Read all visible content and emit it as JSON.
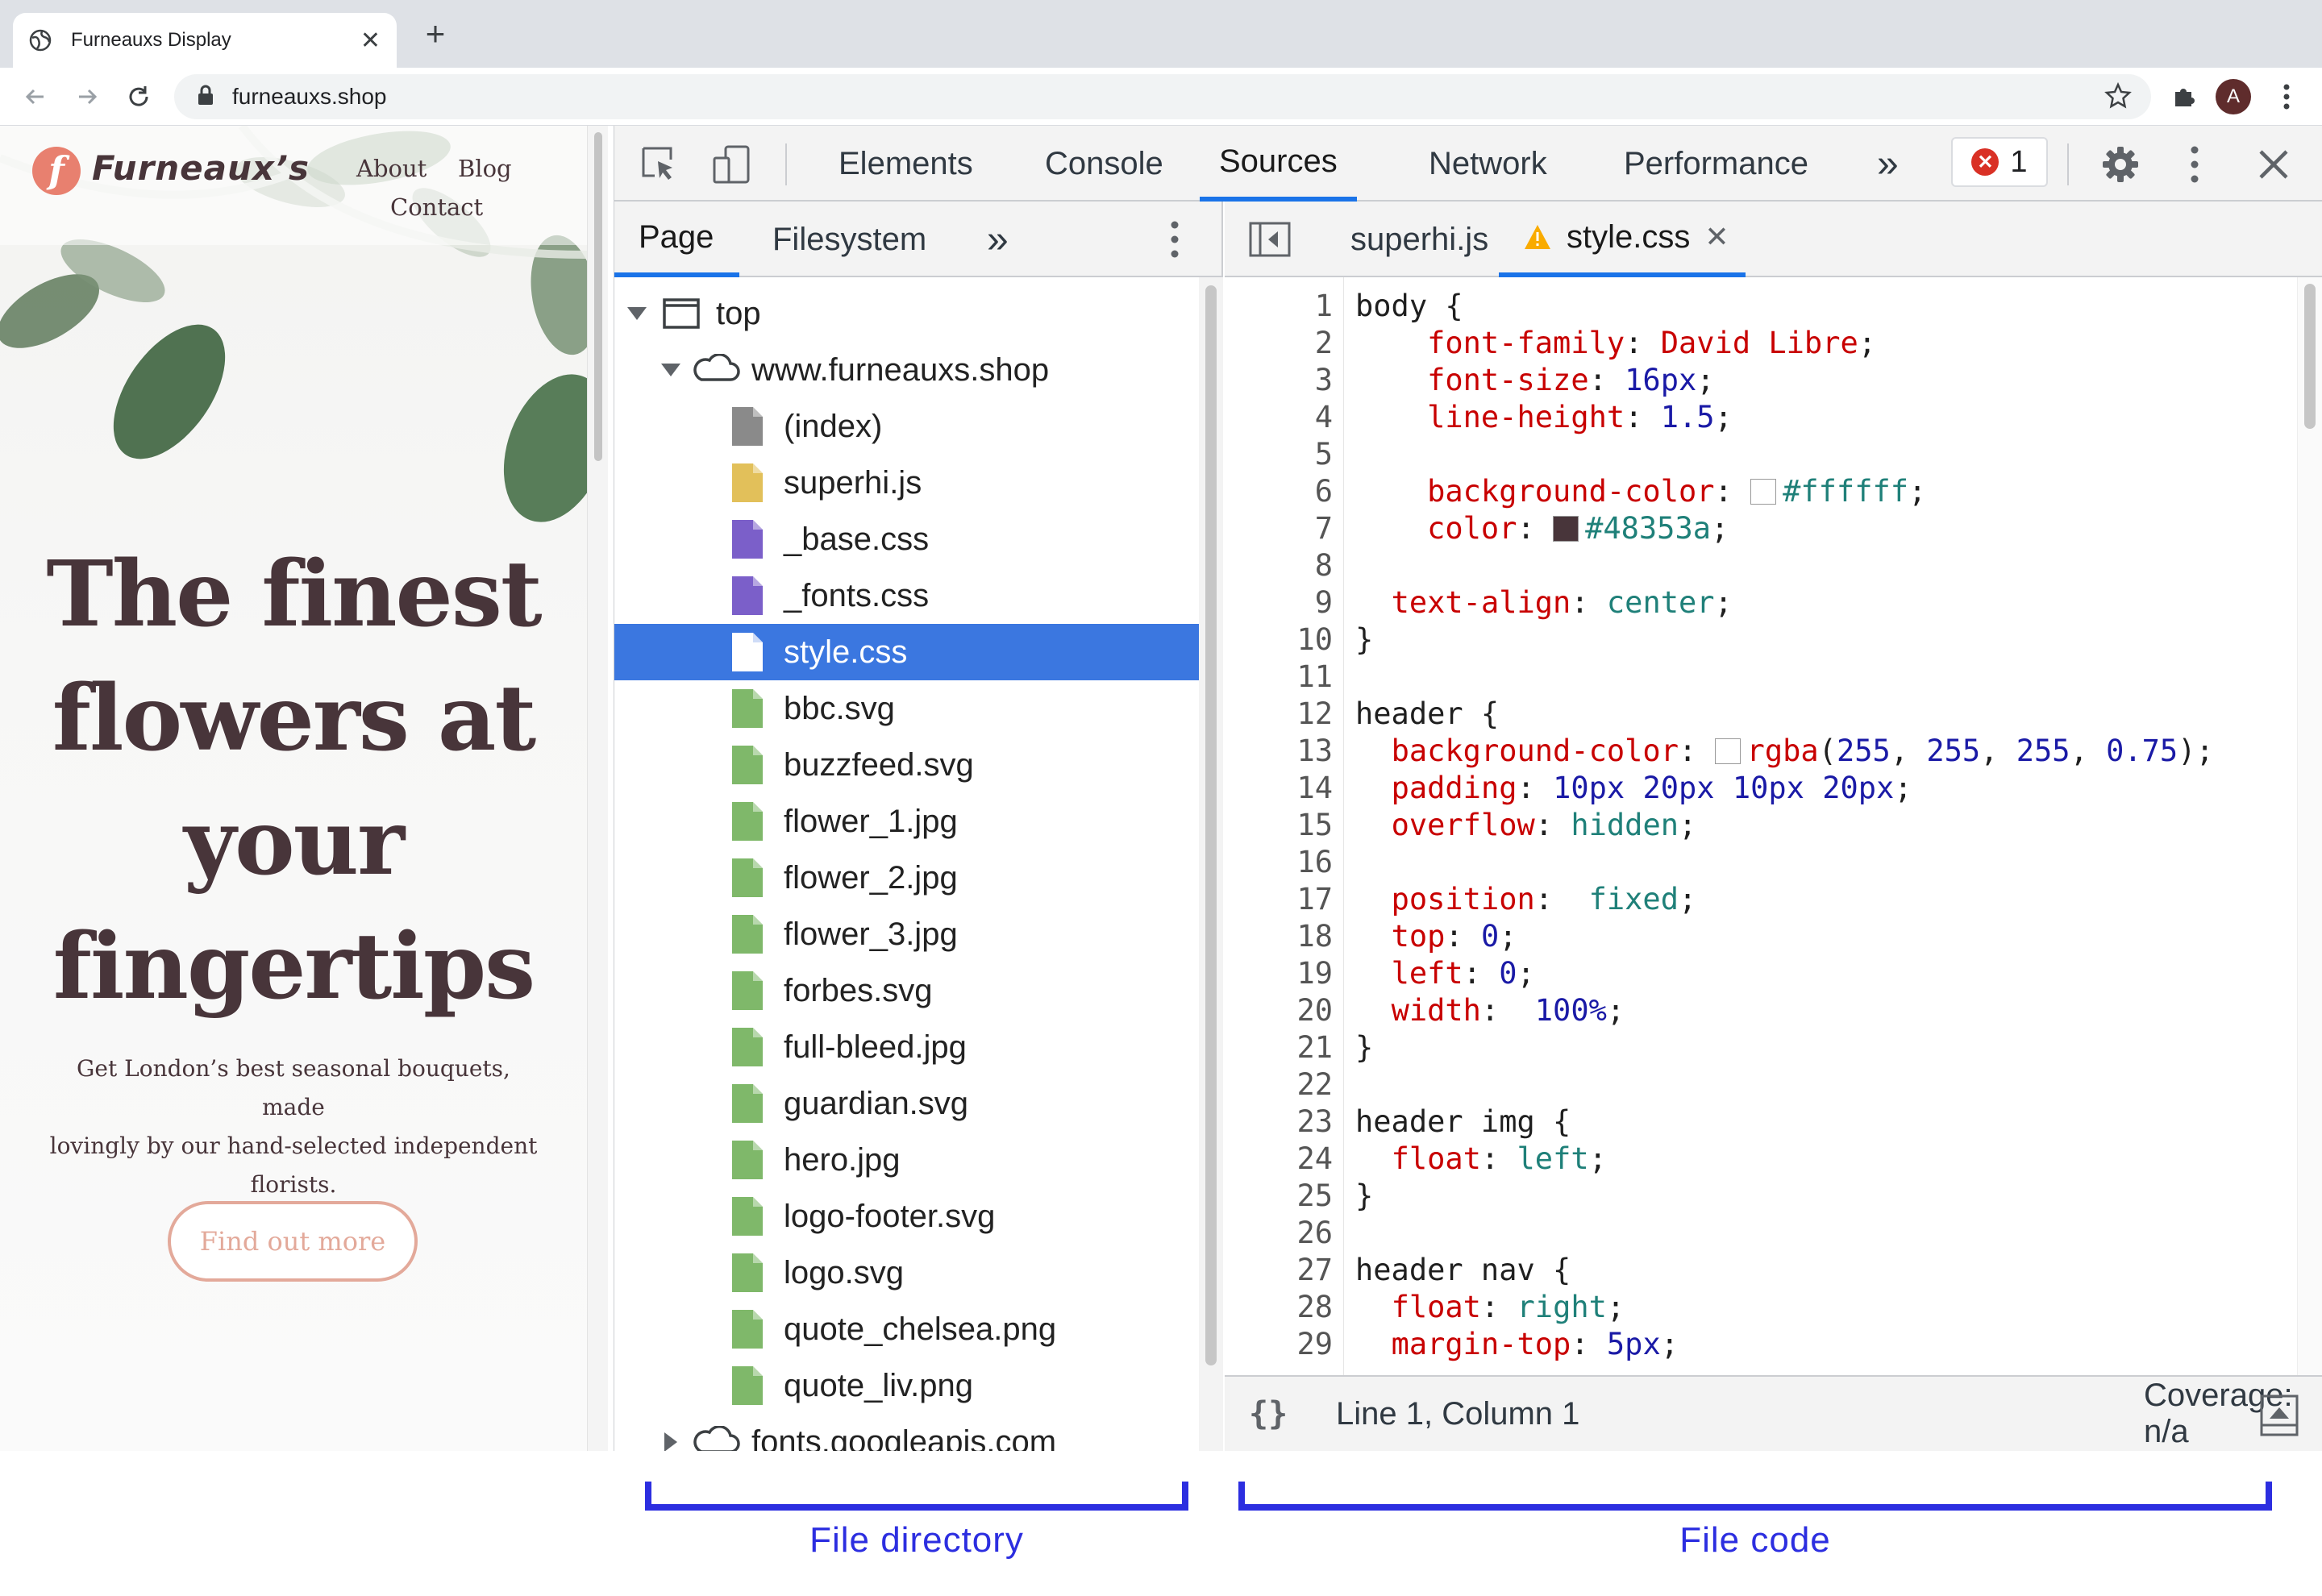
{
  "browser": {
    "tab_title": "Furneauxs Display",
    "url": "furneauxs.shop",
    "avatar_letter": "A"
  },
  "website": {
    "logo_mark": "f",
    "logo_text": "Furneaux’s",
    "nav": [
      "About",
      "Blog",
      "Contact"
    ],
    "hero_title_lines": [
      "The finest",
      "flowers at",
      "your",
      "fingertips"
    ],
    "hero_subtitle_lines": [
      "Get London’s best seasonal bouquets, made",
      "lovingly by our hand-selected independent",
      "florists."
    ],
    "cta_label": "Find out more",
    "colors": {
      "text": "#48353a",
      "accent": "#e3a99a",
      "logo": "#e8806f"
    }
  },
  "devtools": {
    "tabs": [
      "Elements",
      "Console",
      "Sources",
      "Network",
      "Performance"
    ],
    "active_tab": "Sources",
    "more_tabs": "»",
    "error_count": "1",
    "navigator": {
      "tabs": [
        "Page",
        "Filesystem"
      ],
      "active_tab": "Page",
      "more": "»",
      "frame": "top",
      "domain": "www.furneauxs.shop",
      "files": [
        {
          "name": "(index)",
          "kind": "doc"
        },
        {
          "name": "superhi.js",
          "kind": "js"
        },
        {
          "name": "_base.css",
          "kind": "css"
        },
        {
          "name": "_fonts.css",
          "kind": "css"
        },
        {
          "name": "style.css",
          "kind": "css",
          "selected": true
        },
        {
          "name": "bbc.svg",
          "kind": "img"
        },
        {
          "name": "buzzfeed.svg",
          "kind": "img"
        },
        {
          "name": "flower_1.jpg",
          "kind": "img"
        },
        {
          "name": "flower_2.jpg",
          "kind": "img"
        },
        {
          "name": "flower_3.jpg",
          "kind": "img"
        },
        {
          "name": "forbes.svg",
          "kind": "img"
        },
        {
          "name": "full-bleed.jpg",
          "kind": "img"
        },
        {
          "name": "guardian.svg",
          "kind": "img"
        },
        {
          "name": "hero.jpg",
          "kind": "img"
        },
        {
          "name": "logo-footer.svg",
          "kind": "img"
        },
        {
          "name": "logo.svg",
          "kind": "img"
        },
        {
          "name": "quote_chelsea.png",
          "kind": "img"
        },
        {
          "name": "quote_liv.png",
          "kind": "img"
        }
      ],
      "other_domain": "fonts.googleapis.com"
    },
    "editor": {
      "tabs": [
        {
          "name": "superhi.js",
          "active": false,
          "warning": false
        },
        {
          "name": "style.css",
          "active": true,
          "warning": true
        }
      ],
      "lines": [
        [
          [
            "t",
            "body {"
          ]
        ],
        [
          [
            "t",
            "    "
          ],
          [
            "p",
            "font-family"
          ],
          [
            "t",
            ": "
          ],
          [
            "p",
            "David Libre"
          ],
          [
            "t",
            ";"
          ]
        ],
        [
          [
            "t",
            "    "
          ],
          [
            "p",
            "font-size"
          ],
          [
            "t",
            ": "
          ],
          [
            "v",
            "16px"
          ],
          [
            "t",
            ";"
          ]
        ],
        [
          [
            "t",
            "    "
          ],
          [
            "p",
            "line-height"
          ],
          [
            "t",
            ": "
          ],
          [
            "v",
            "1.5"
          ],
          [
            "t",
            ";"
          ]
        ],
        [],
        [
          [
            "t",
            "    "
          ],
          [
            "p",
            "background-color"
          ],
          [
            "t",
            ": "
          ],
          [
            "sw",
            "#ffffff"
          ],
          [
            "k",
            "#ffffff"
          ],
          [
            "t",
            ";"
          ]
        ],
        [
          [
            "t",
            "    "
          ],
          [
            "p",
            "color"
          ],
          [
            "t",
            ": "
          ],
          [
            "sw",
            "#48353a"
          ],
          [
            "k",
            "#48353a"
          ],
          [
            "t",
            ";"
          ]
        ],
        [],
        [
          [
            "t",
            "  "
          ],
          [
            "p",
            "text-align"
          ],
          [
            "t",
            ": "
          ],
          [
            "k",
            "center"
          ],
          [
            "t",
            ";"
          ]
        ],
        [
          [
            "t",
            "}"
          ]
        ],
        [],
        [
          [
            "t",
            "header {"
          ]
        ],
        [
          [
            "t",
            "  "
          ],
          [
            "p",
            "background-color"
          ],
          [
            "t",
            ": "
          ],
          [
            "sw",
            "rgba(255,255,255,0.75)"
          ],
          [
            "p",
            "rgba"
          ],
          [
            "t",
            "("
          ],
          [
            "v",
            "255"
          ],
          [
            "t",
            ", "
          ],
          [
            "v",
            "255"
          ],
          [
            "t",
            ", "
          ],
          [
            "v",
            "255"
          ],
          [
            "t",
            ", "
          ],
          [
            "v",
            "0.75"
          ],
          [
            "t",
            ");"
          ]
        ],
        [
          [
            "t",
            "  "
          ],
          [
            "p",
            "padding"
          ],
          [
            "t",
            ": "
          ],
          [
            "v",
            "10px 20px 10px 20px"
          ],
          [
            "t",
            ";"
          ]
        ],
        [
          [
            "t",
            "  "
          ],
          [
            "p",
            "overflow"
          ],
          [
            "t",
            ": "
          ],
          [
            "k",
            "hidden"
          ],
          [
            "t",
            ";"
          ]
        ],
        [],
        [
          [
            "t",
            "  "
          ],
          [
            "p",
            "position"
          ],
          [
            "t",
            ":  "
          ],
          [
            "k",
            "fixed"
          ],
          [
            "t",
            ";"
          ]
        ],
        [
          [
            "t",
            "  "
          ],
          [
            "p",
            "top"
          ],
          [
            "t",
            ": "
          ],
          [
            "v",
            "0"
          ],
          [
            "t",
            ";"
          ]
        ],
        [
          [
            "t",
            "  "
          ],
          [
            "p",
            "left"
          ],
          [
            "t",
            ": "
          ],
          [
            "v",
            "0"
          ],
          [
            "t",
            ";"
          ]
        ],
        [
          [
            "t",
            "  "
          ],
          [
            "p",
            "width"
          ],
          [
            "t",
            ":  "
          ],
          [
            "v",
            "100%"
          ],
          [
            "t",
            ";"
          ]
        ],
        [
          [
            "t",
            "}"
          ]
        ],
        [],
        [
          [
            "t",
            "header img {"
          ]
        ],
        [
          [
            "t",
            "  "
          ],
          [
            "p",
            "float"
          ],
          [
            "t",
            ": "
          ],
          [
            "k",
            "left"
          ],
          [
            "t",
            ";"
          ]
        ],
        [
          [
            "t",
            "}"
          ]
        ],
        [],
        [
          [
            "t",
            "header nav {"
          ]
        ],
        [
          [
            "t",
            "  "
          ],
          [
            "p",
            "float"
          ],
          [
            "t",
            ": "
          ],
          [
            "k",
            "right"
          ],
          [
            "t",
            ";"
          ]
        ],
        [
          [
            "t",
            "  "
          ],
          [
            "p",
            "margin-top"
          ],
          [
            "t",
            ": "
          ],
          [
            "v",
            "5px"
          ],
          [
            "t",
            ";"
          ]
        ]
      ]
    },
    "status": {
      "format_icon": "{}",
      "position": "Line 1, Column 1",
      "coverage": "Coverage: n/a"
    }
  },
  "annotations": {
    "left": "File directory",
    "right": "File code",
    "color": "#2c2ee0"
  }
}
